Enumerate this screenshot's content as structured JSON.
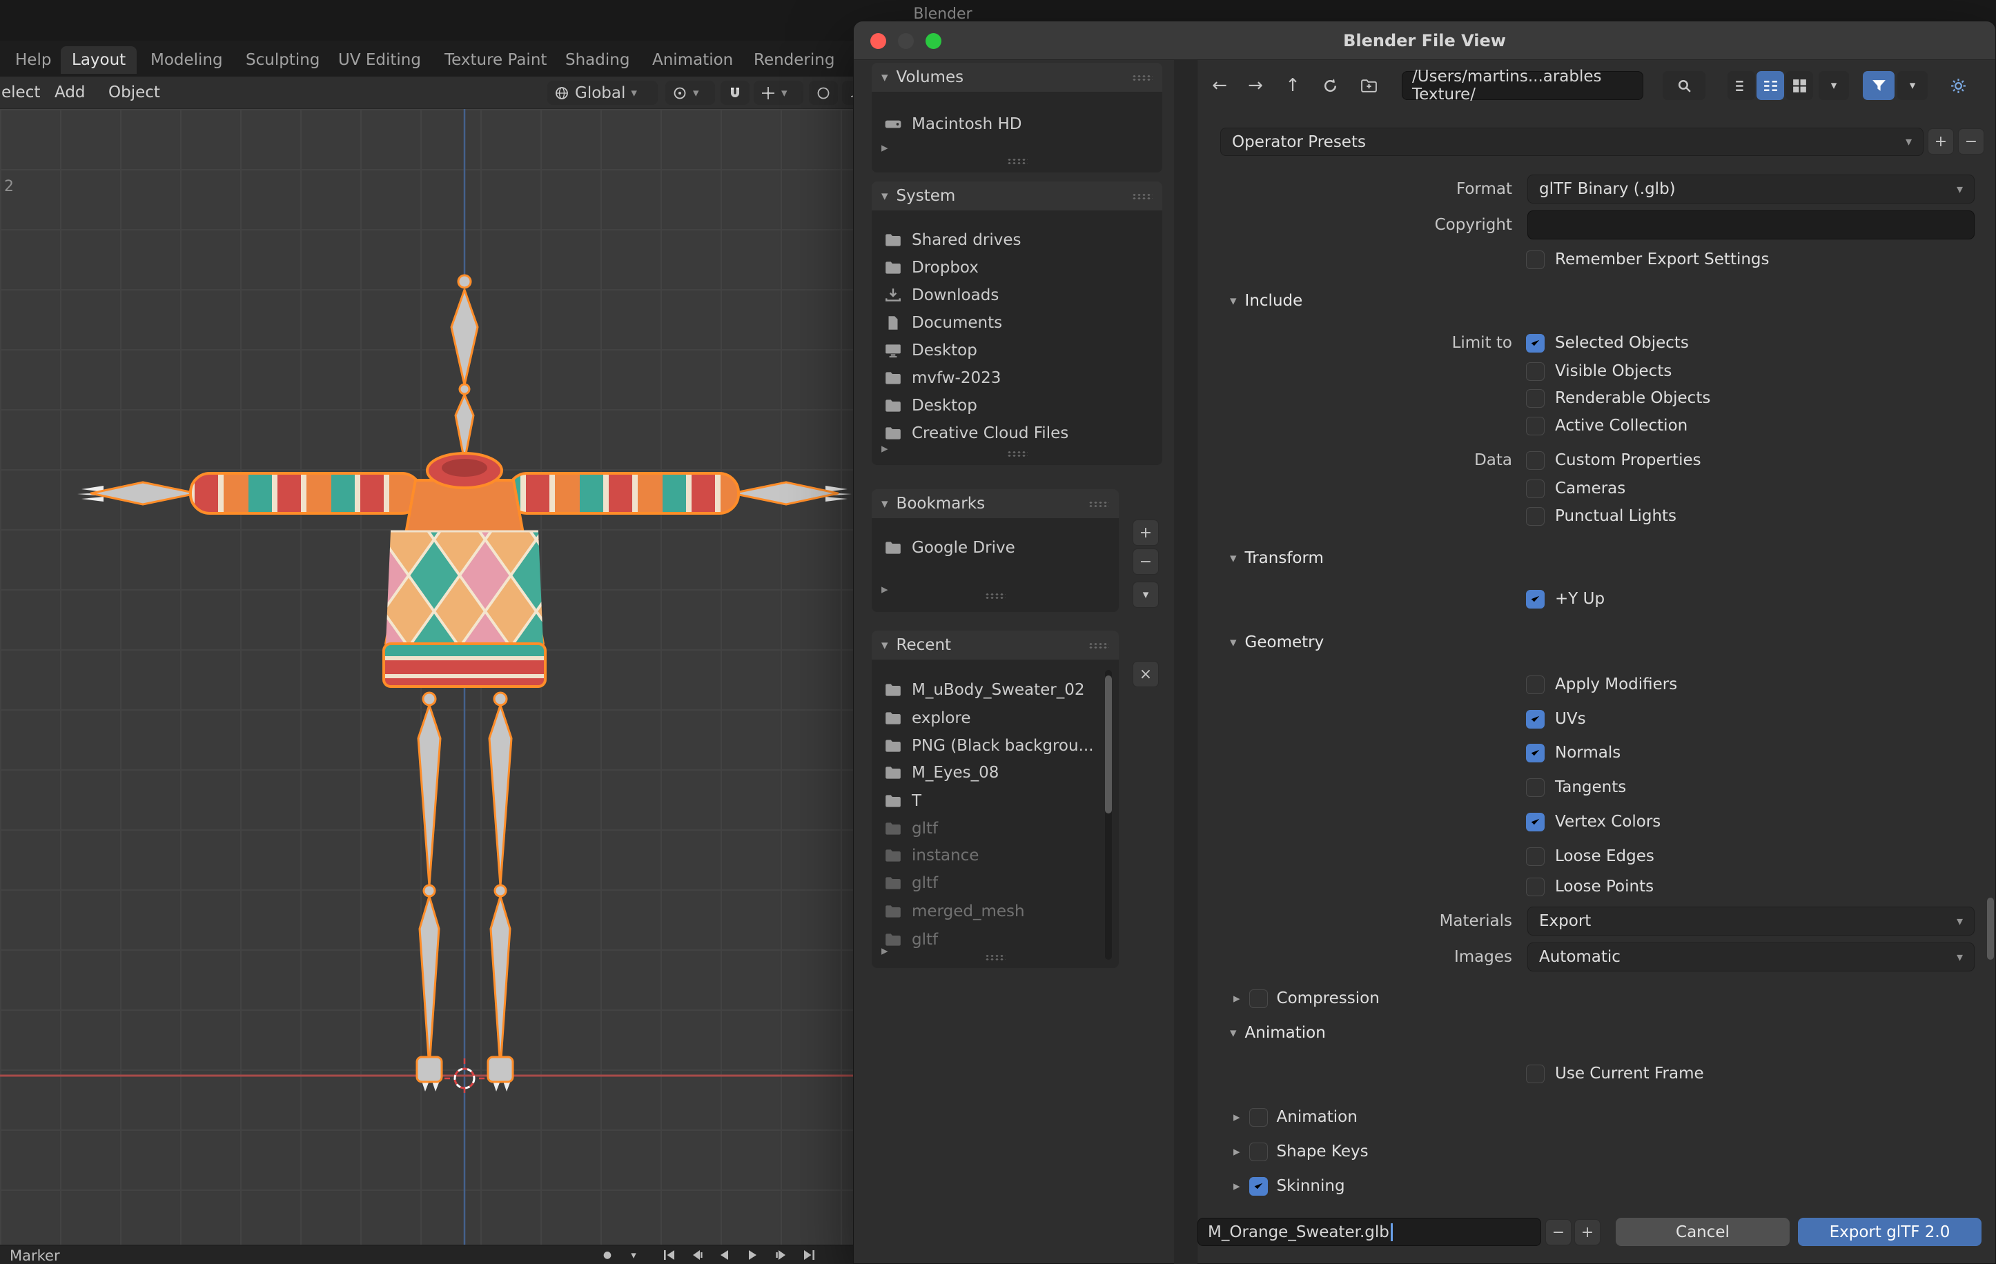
{
  "colors": {
    "accent": "#4772b3",
    "checkbox_checked": "#4d80cf",
    "selection_outline": "#ff8d29",
    "export_button": "#4772b3"
  },
  "icons": {
    "chevron_down": "▾",
    "expand_right": "▸",
    "back": "←",
    "forward": "→",
    "up": "↑",
    "plus": "+",
    "minus": "−",
    "close": "×",
    "record_dot": "●"
  },
  "background": {
    "window_title": "Blender",
    "menu": "Help",
    "tabs": [
      "Layout",
      "Modeling",
      "Sculpting",
      "UV Editing",
      "Texture Paint",
      "Shading",
      "Animation",
      "Rendering"
    ],
    "active_tab": "Layout",
    "toolbar": {
      "select": "elect",
      "add": "Add",
      "object": "Object",
      "orientation": "Global"
    },
    "frame_number": "2",
    "timeline_label": "Marker"
  },
  "dialog": {
    "title": "Blender File View",
    "nav": {
      "path": "/Users/martins...arables Texture/"
    },
    "sidebar": {
      "volumes": {
        "title": "Volumes",
        "items": [
          {
            "label": "Macintosh HD",
            "icon": "hard-drive-icon"
          }
        ]
      },
      "system": {
        "title": "System",
        "items": [
          {
            "label": "Shared drives",
            "icon": "folder-icon"
          },
          {
            "label": "Dropbox",
            "icon": "folder-icon"
          },
          {
            "label": "Downloads",
            "icon": "download-icon"
          },
          {
            "label": "Documents",
            "icon": "documents-icon"
          },
          {
            "label": "Desktop",
            "icon": "desktop-icon"
          },
          {
            "label": "mvfw-2023",
            "icon": "folder-icon"
          },
          {
            "label": "Desktop",
            "icon": "folder-icon"
          },
          {
            "label": "Creative Cloud Files",
            "icon": "folder-icon"
          }
        ]
      },
      "bookmarks": {
        "title": "Bookmarks",
        "items": [
          {
            "label": "Google Drive",
            "icon": "folder-icon"
          }
        ]
      },
      "recent": {
        "title": "Recent",
        "items": [
          {
            "label": "M_uBody_Sweater_02",
            "icon": "folder-icon",
            "dim": false
          },
          {
            "label": "explore",
            "icon": "folder-icon",
            "dim": false
          },
          {
            "label": "PNG (Black backgrou...",
            "icon": "folder-icon",
            "dim": false
          },
          {
            "label": "M_Eyes_08",
            "icon": "folder-icon",
            "dim": false
          },
          {
            "label": "T",
            "icon": "folder-icon",
            "dim": false
          },
          {
            "label": "gltf",
            "icon": "folder-icon",
            "dim": true
          },
          {
            "label": "instance",
            "icon": "folder-icon",
            "dim": true
          },
          {
            "label": "gltf",
            "icon": "folder-icon",
            "dim": true
          },
          {
            "label": "merged_mesh",
            "icon": "folder-icon",
            "dim": true
          },
          {
            "label": "gltf",
            "icon": "folder-icon",
            "dim": true
          }
        ]
      }
    },
    "presets": {
      "label": "Operator Presets"
    },
    "fields": {
      "format": {
        "label": "Format",
        "value": "glTF Binary (.glb)"
      },
      "copyright": {
        "label": "Copyright",
        "value": ""
      },
      "remember": {
        "label": "Remember Export Settings",
        "checked": false
      }
    },
    "include": {
      "title": "Include",
      "limit_label": "Limit to",
      "data_label": "Data",
      "selected_objects": {
        "label": "Selected Objects",
        "checked": true
      },
      "visible_objects": {
        "label": "Visible Objects",
        "checked": false
      },
      "renderable_objects": {
        "label": "Renderable Objects",
        "checked": false
      },
      "active_collection": {
        "label": "Active Collection",
        "checked": false
      },
      "custom_properties": {
        "label": "Custom Properties",
        "checked": false
      },
      "cameras": {
        "label": "Cameras",
        "checked": false
      },
      "punctual_lights": {
        "label": "Punctual Lights",
        "checked": false
      }
    },
    "transform": {
      "title": "Transform",
      "y_up": {
        "label": "+Y Up",
        "checked": true
      }
    },
    "geometry": {
      "title": "Geometry",
      "apply_modifiers": {
        "label": "Apply Modifiers",
        "checked": false
      },
      "uvs": {
        "label": "UVs",
        "checked": true
      },
      "normals": {
        "label": "Normals",
        "checked": true
      },
      "tangents": {
        "label": "Tangents",
        "checked": false
      },
      "vertex_colors": {
        "label": "Vertex Colors",
        "checked": true
      },
      "loose_edges": {
        "label": "Loose Edges",
        "checked": false
      },
      "loose_points": {
        "label": "Loose Points",
        "checked": false
      },
      "materials": {
        "label": "Materials",
        "value": "Export"
      },
      "images": {
        "label": "Images",
        "value": "Automatic"
      }
    },
    "compression": {
      "label": "Compression",
      "checked": false
    },
    "animation": {
      "title": "Animation",
      "use_current_frame": {
        "label": "Use Current Frame",
        "checked": false
      },
      "animation": {
        "label": "Animation",
        "checked": false
      },
      "shape_keys": {
        "label": "Shape Keys",
        "checked": false
      },
      "skinning": {
        "label": "Skinning",
        "checked": true
      }
    },
    "footer": {
      "filename": "M_Orange_Sweater.glb",
      "cancel": "Cancel",
      "export": "Export glTF 2.0"
    }
  }
}
